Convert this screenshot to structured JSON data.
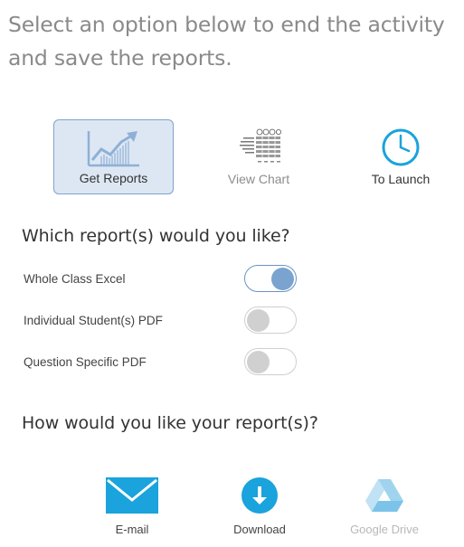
{
  "header": {
    "instruction": "Select an option below to end the activity and save the reports."
  },
  "actions": [
    {
      "label": "Get Reports",
      "icon": "growth-chart-icon",
      "selected": true
    },
    {
      "label": "View Chart",
      "icon": "table-chart-icon",
      "selected": false
    },
    {
      "label": "To Launch",
      "icon": "clock-icon",
      "selected": false
    }
  ],
  "reports": {
    "question": "Which report(s) would you like?",
    "options": [
      {
        "label": "Whole Class Excel",
        "enabled": true
      },
      {
        "label": "Individual Student(s) PDF",
        "enabled": false
      },
      {
        "label": "Question Specific PDF",
        "enabled": false
      }
    ]
  },
  "delivery": {
    "question": "How would you like your report(s)?",
    "methods": [
      {
        "label": "E-mail",
        "icon": "envelope-icon"
      },
      {
        "label": "Download",
        "icon": "download-icon"
      },
      {
        "label": "Google Drive",
        "icon": "google-drive-icon"
      }
    ]
  },
  "colors": {
    "accent": "#1aa3dc",
    "selected_bg": "#dde7f3",
    "toggle_on": "#7aa3cf",
    "disabled_text": "#b8b8b8"
  }
}
